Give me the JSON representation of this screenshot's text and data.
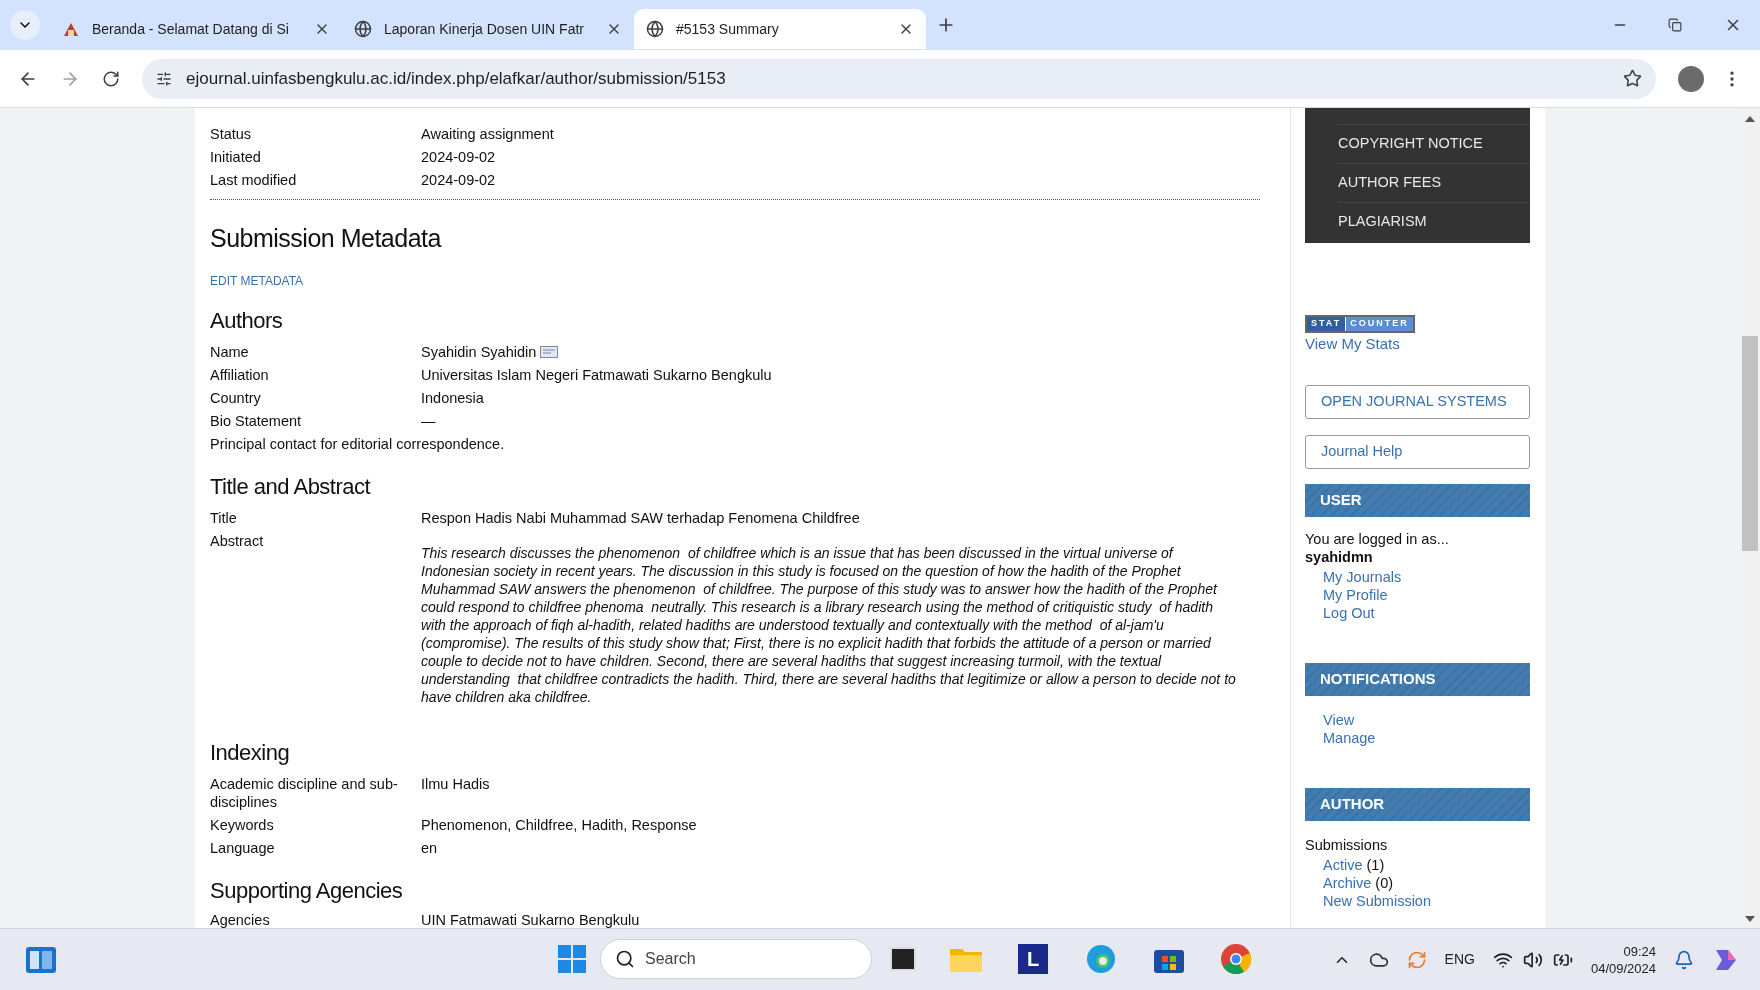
{
  "browser": {
    "tabs": [
      {
        "title": "Beranda - Selamat Datang di Si",
        "selected": false,
        "kind": "site-logo"
      },
      {
        "title": "Laporan Kinerja Dosen UIN Fatr",
        "selected": false,
        "kind": "globe"
      },
      {
        "title": "#5153 Summary",
        "selected": true,
        "kind": "globe"
      }
    ],
    "address": "ejournal.uinfasbengkulu.ac.id/index.php/elafkar/author/submission/5153"
  },
  "status_rows": [
    {
      "label": "Status",
      "value": "Awaiting assignment"
    },
    {
      "label": "Initiated",
      "value": "2024-09-02"
    },
    {
      "label": "Last modified",
      "value": "2024-09-02"
    }
  ],
  "metadata": {
    "title": "Submission Metadata",
    "edit_link": "EDIT METADATA",
    "authors": {
      "title": "Authors",
      "rows": [
        {
          "label": "Name",
          "value": "Syahidin Syahidin",
          "kind": "email"
        },
        {
          "label": "Affiliation",
          "value": "Universitas Islam Negeri Fatmawati Sukarno Bengkulu",
          "kind": "plain"
        },
        {
          "label": "Country",
          "value": "Indonesia",
          "kind": "plain"
        },
        {
          "label": "Bio Statement",
          "value": "—",
          "kind": "plain"
        }
      ],
      "note": "Principal contact for editorial correspondence."
    },
    "title_abstract": {
      "title": "Title and Abstract",
      "title_label": "Title",
      "title_value": "Respon Hadis Nabi Muhammad SAW terhadap Fenomena Childfree",
      "abstract_label": "Abstract",
      "abstract": "This research discusses the phenomenon  of childfree which is an issue that has been discussed in the virtual universe of Indonesian society in recent years. The discussion in this study is focused on the question of how the hadith of the Prophet Muhammad SAW answers the phenomenon  of childfree. The purpose of this study was to answer how the hadith of the Prophet could respond to childfree phenoma  neutrally. This research is a library research using the method of critiquistic study  of hadith with the approach of fiqh al-hadith, related hadiths are understood textually and contextually with the method  of al-jam'u (compromise). The results of this study show that; First, there is no explicit hadith that forbids the attitude of a person or married couple to decide not to have children. Second, there are several hadiths that suggest increasing turmoil, with the textual understanding  that childfree contradicts the hadith. Third, there are several hadiths that legitimize or allow a person to decide not to have children aka childfree."
    },
    "indexing": {
      "title": "Indexing",
      "rows": [
        {
          "label": "Academic discipline and sub-disciplines",
          "value": "Ilmu Hadis"
        },
        {
          "label": "Keywords",
          "value": "Phenomenon, Childfree, Hadith, Response"
        },
        {
          "label": "Language",
          "value": "en"
        }
      ]
    },
    "agencies": {
      "title": "Supporting Agencies",
      "rows": [
        {
          "label": "Agencies",
          "value": "UIN Fatmawati Sukarno Bengkulu"
        }
      ]
    }
  },
  "sidebar": {
    "menu": [
      "COPYRIGHT NOTICE",
      "AUTHOR FEES",
      "PLAGIARISM"
    ],
    "statcounter": [
      "STAT",
      "COUNTER"
    ],
    "stats_link": "View My Stats",
    "boxes": [
      "OPEN JOURNAL SYSTEMS",
      "Journal Help"
    ],
    "user": {
      "title": "USER",
      "logged_in": "You are logged in as...",
      "username": "syahidmn",
      "links": [
        "My Journals",
        "My Profile",
        "Log Out"
      ]
    },
    "notifications": {
      "title": "NOTIFICATIONS",
      "links": [
        "View",
        "Manage"
      ]
    },
    "author": {
      "title": "AUTHOR",
      "label": "Submissions",
      "links": [
        {
          "text": "Active",
          "count": "(1)"
        },
        {
          "text": "Archive",
          "count": "(0)"
        },
        {
          "text": "New Submission"
        }
      ]
    }
  },
  "taskbar": {
    "app_letter": "L",
    "search": "Search",
    "lang": "ENG",
    "time": "09:24",
    "date": "04/09/2024"
  }
}
